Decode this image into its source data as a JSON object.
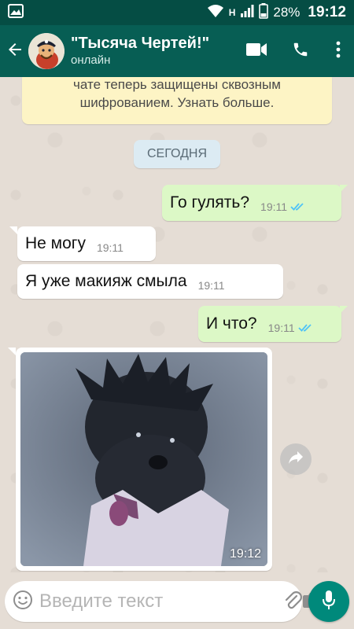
{
  "status_bar": {
    "network_type": "H",
    "battery_percent": "28%",
    "time": "19:12"
  },
  "header": {
    "title": "\"Тысяча Чертей!\"",
    "status": "онлайн"
  },
  "encryption_notice": {
    "lines": [
      "чате теперь защищены сквозным",
      "шифрованием. Узнать больше."
    ]
  },
  "date_separator": "СЕГОДНЯ",
  "messages": [
    {
      "direction": "out",
      "text": "Го гулять?",
      "time": "19:11",
      "read": true
    },
    {
      "direction": "in",
      "text": "Не могу",
      "time": "19:11"
    },
    {
      "direction": "in",
      "text": "Я уже макияж смыла",
      "time": "19:11"
    },
    {
      "direction": "out",
      "text": "И что?",
      "time": "19:11",
      "read": true
    }
  ],
  "photo_message": {
    "time": "19:12"
  },
  "composer": {
    "placeholder": "Введите текст"
  },
  "colors": {
    "header": "#075e54",
    "status_bar": "#054d44",
    "outgoing_bubble": "#dcf8c6",
    "incoming_bubble": "#ffffff",
    "read_ticks": "#4fc3f7",
    "mic_button": "#00897b"
  },
  "icons": {
    "header": [
      "back-arrow-icon",
      "video-call-icon",
      "phone-icon",
      "more-vert-icon"
    ],
    "composer": [
      "emoji-icon",
      "attach-icon",
      "camera-icon",
      "mic-icon"
    ]
  }
}
